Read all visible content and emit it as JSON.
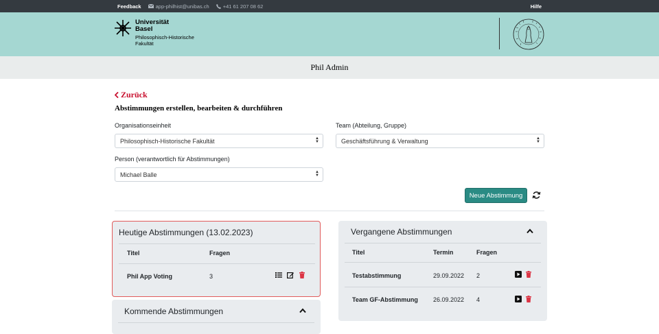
{
  "topbar": {
    "feedback": "Feedback",
    "email": "app-philhist@unibas.ch",
    "phone": "+41 61 207 08 62",
    "help": "Hilfe"
  },
  "logo": {
    "line1": "Universität",
    "line2": "Basel",
    "line3": "Philosophisch-Historische",
    "line4": "Fakultät"
  },
  "subheader": {
    "title": "Phil Admin"
  },
  "nav": {
    "back": "Zurück"
  },
  "page": {
    "title": "Abstimmungen erstellen, bearbeiten & durchführen"
  },
  "filters": {
    "org_label": "Organisationseinheit",
    "org_value": "Philosophisch-Historische Fakultät",
    "team_label": "Team (Abteilung, Gruppe)",
    "team_value": "Geschäftsführung & Verwaltung",
    "person_label": "Person (verantwortlich für Abstimmungen)",
    "person_value": "Michael Balle"
  },
  "actions": {
    "new_vote": "Neue Abstimmung"
  },
  "today": {
    "title": "Heutige Abstimmungen (13.02.2023)",
    "col_title": "Titel",
    "col_questions": "Fragen",
    "rows": [
      {
        "title": "Phil App Voting",
        "questions": "3"
      }
    ]
  },
  "upcoming": {
    "title": "Kommende Abstimmungen"
  },
  "past": {
    "title": "Vergangene Abstimmungen",
    "col_title": "Titel",
    "col_date": "Termin",
    "col_questions": "Fragen",
    "rows": [
      {
        "title": "Testabstimmung",
        "date": "29.09.2022",
        "questions": "2"
      },
      {
        "title": "Team GF-Abstimmung",
        "date": "26.09.2022",
        "questions": "4"
      }
    ]
  },
  "colors": {
    "accent": "#2a8b84",
    "header_bg": "#a5d7d2",
    "danger": "#c8102e"
  }
}
